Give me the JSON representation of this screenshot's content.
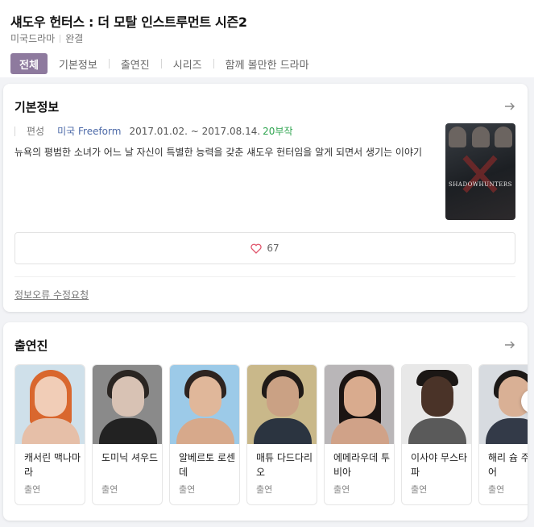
{
  "header": {
    "title": "섀도우 헌터스 : 더 모탈 인스트루먼트 시즌2",
    "genre": "미국드라마",
    "status": "완결",
    "tabs": [
      "전체",
      "기본정보",
      "출연진",
      "시리즈",
      "함께 볼만한 드라마"
    ],
    "active_tab_color": "#8e7a9e"
  },
  "basic_info": {
    "title": "기본정보",
    "label": "편성",
    "network": "미국 Freeform",
    "dates": "2017.01.02. ~ 2017.08.14.",
    "episodes": "20부작",
    "description": "뉴욕의 평범한 소녀가 어느 날 자신이 특별한 능력을 갖춘 섀도우 헌터임을 알게 되면서 생기는 이야기",
    "poster_logo": "SHADOWHUNTERS",
    "likes": "67",
    "report_link": "정보오류 수정요청",
    "arrow_icon": "arrow-right-icon"
  },
  "cast": {
    "title": "출연진",
    "members": [
      {
        "name": "캐서린 맥나마라",
        "role": "출연"
      },
      {
        "name": "도미닉 셔우드",
        "role": "출연"
      },
      {
        "name": "알베르토 로센데",
        "role": "출연"
      },
      {
        "name": "매튜 다드다리오",
        "role": "출연"
      },
      {
        "name": "에메라우데 투비아",
        "role": "출연"
      },
      {
        "name": "이사야 무스타파",
        "role": "출연"
      },
      {
        "name": "해리 슘 주니어",
        "role": "출연"
      }
    ]
  }
}
